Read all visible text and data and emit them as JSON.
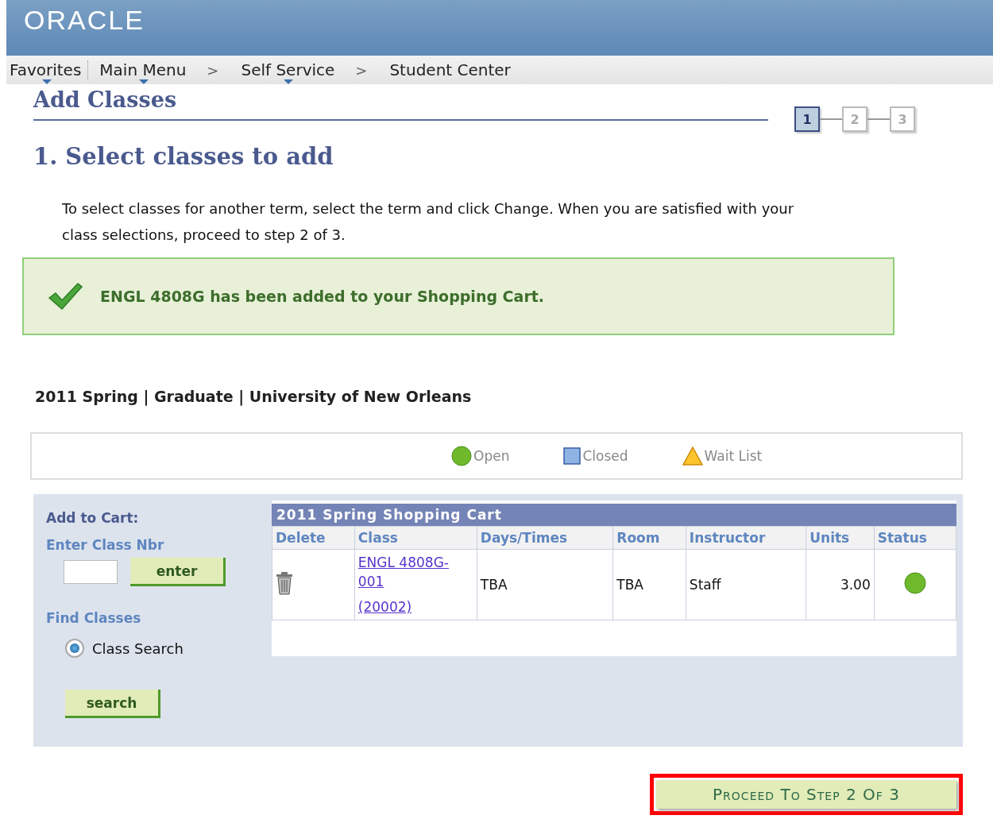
{
  "header": {
    "logo": "ORACLE"
  },
  "breadcrumb": [
    {
      "label": "Favorites",
      "dropdown": true
    },
    {
      "label": "Main Menu",
      "dropdown": true
    },
    {
      "label": ">",
      "kind": "separator"
    },
    {
      "label": "Self Service",
      "dropdown": true
    },
    {
      "label": ">",
      "kind": "separator"
    },
    {
      "label": "Student Center",
      "dropdown": false
    }
  ],
  "page_title": "Add Classes",
  "steps": [
    {
      "label": "1",
      "selected": true
    },
    {
      "label": "2",
      "selected": false
    },
    {
      "label": "3",
      "selected": false
    }
  ],
  "step_heading": "1.  Select classes to add",
  "instructions": "To select classes for another term, select the term and click Change.  When you are satisfied with your class selections, proceed to step 2 of 3.",
  "success_message": "ENGL 4808G has been added to your Shopping Cart.",
  "term_line": "2011 Spring | Graduate | University of New Orleans",
  "legend": [
    {
      "kind": "open",
      "label": "Open"
    },
    {
      "kind": "closed",
      "label": "Closed"
    },
    {
      "kind": "waitlist",
      "label": "Wait List"
    }
  ],
  "add_panel": {
    "title": "Add to Cart:",
    "class_nbr_label": "Enter Class Nbr",
    "enter_button": "enter",
    "find_label": "Find Classes",
    "radio": {
      "label": "Class Search",
      "checked": true
    },
    "search_button": "search"
  },
  "cart": {
    "title": "2011 Spring Shopping Cart",
    "columns": [
      "Delete",
      "Class",
      "Days/Times",
      "Room",
      "Instructor",
      "Units",
      "Status"
    ],
    "rows": [
      {
        "class_lines": [
          "ENGL 4808G-",
          "001",
          "(20002)"
        ],
        "days_times": "TBA",
        "room": "TBA",
        "instructor": "Staff",
        "units": "3.00",
        "status": {
          "kind": "open"
        }
      }
    ]
  },
  "proceed_button": "Proceed To Step 2 Of 3"
}
